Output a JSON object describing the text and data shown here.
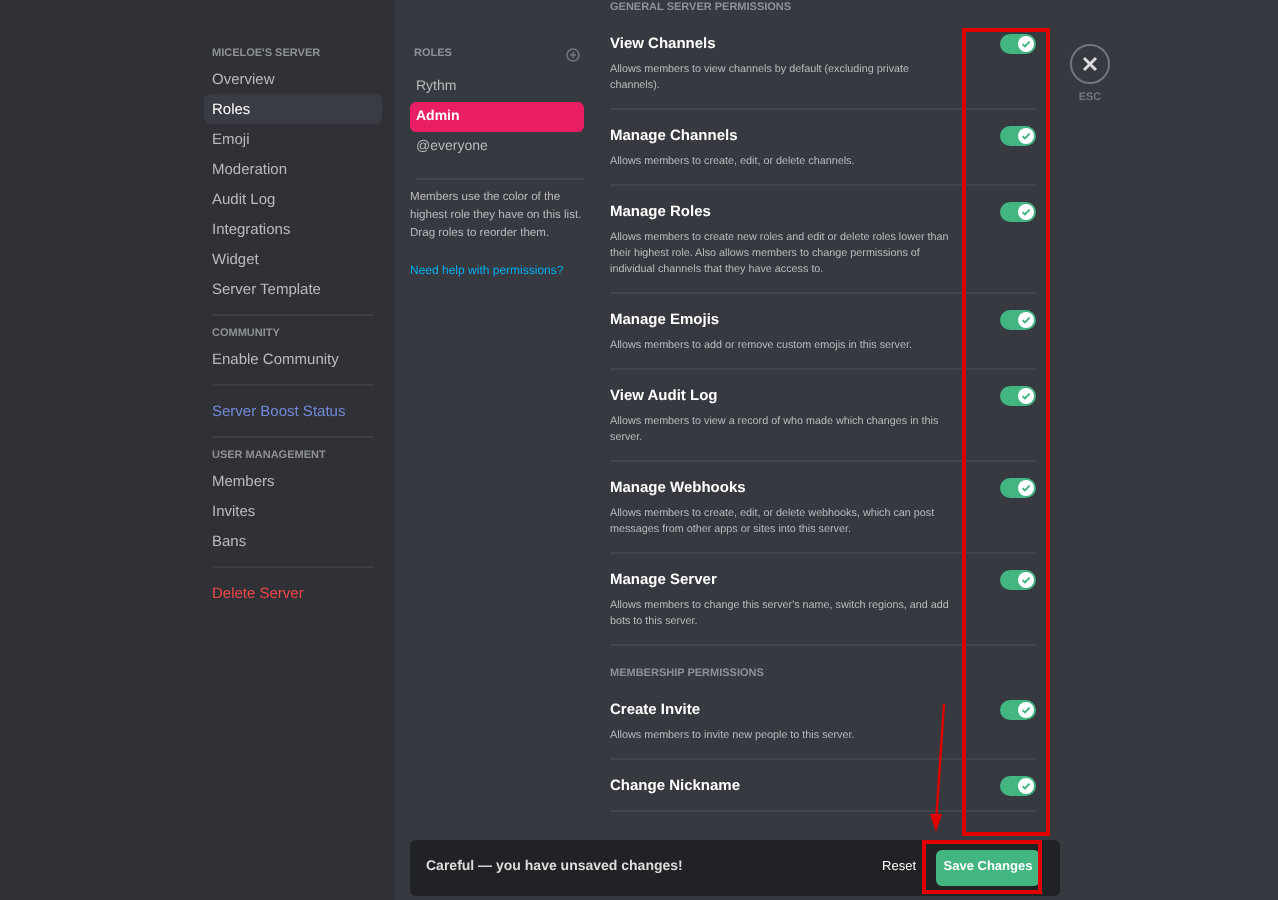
{
  "sidebar": {
    "server_heading": "MICELOE'S SERVER",
    "sections": [
      {
        "items": [
          {
            "label": "Overview",
            "selected": false,
            "kind": "normal"
          },
          {
            "label": "Roles",
            "selected": true,
            "kind": "normal"
          },
          {
            "label": "Emoji",
            "selected": false,
            "kind": "normal"
          },
          {
            "label": "Moderation",
            "selected": false,
            "kind": "normal"
          },
          {
            "label": "Audit Log",
            "selected": false,
            "kind": "normal"
          },
          {
            "label": "Integrations",
            "selected": false,
            "kind": "normal"
          },
          {
            "label": "Widget",
            "selected": false,
            "kind": "normal"
          },
          {
            "label": "Server Template",
            "selected": false,
            "kind": "normal"
          }
        ]
      },
      {
        "heading": "COMMUNITY",
        "items": [
          {
            "label": "Enable Community",
            "selected": false,
            "kind": "normal"
          }
        ]
      },
      {
        "items": [
          {
            "label": "Server Boost Status",
            "selected": false,
            "kind": "boost"
          }
        ]
      },
      {
        "heading": "USER MANAGEMENT",
        "items": [
          {
            "label": "Members",
            "selected": false,
            "kind": "normal"
          },
          {
            "label": "Invites",
            "selected": false,
            "kind": "normal"
          },
          {
            "label": "Bans",
            "selected": false,
            "kind": "normal"
          }
        ]
      },
      {
        "items": [
          {
            "label": "Delete Server",
            "selected": false,
            "kind": "danger"
          }
        ]
      }
    ]
  },
  "roles_panel": {
    "heading": "ROLES",
    "roles": [
      {
        "name": "Rythm",
        "selected": false
      },
      {
        "name": "Admin",
        "selected": true
      },
      {
        "name": "@everyone",
        "selected": false
      }
    ],
    "hint": "Members use the color of the highest role they have on this list. Drag roles to reorder them.",
    "help_link": "Need help with permissions?"
  },
  "permissions": {
    "sections": [
      {
        "heading": "GENERAL SERVER PERMISSIONS",
        "items": [
          {
            "title": "View Channels",
            "description": "Allows members to view channels by default (excluding private channels).",
            "enabled": true
          },
          {
            "title": "Manage Channels",
            "description": "Allows members to create, edit, or delete channels.",
            "enabled": true
          },
          {
            "title": "Manage Roles",
            "description": "Allows members to create new roles and edit or delete roles lower than their highest role. Also allows members to change permissions of individual channels that they have access to.",
            "enabled": true
          },
          {
            "title": "Manage Emojis",
            "description": "Allows members to add or remove custom emojis in this server.",
            "enabled": true
          },
          {
            "title": "View Audit Log",
            "description": "Allows members to view a record of who made which changes in this server.",
            "enabled": true
          },
          {
            "title": "Manage Webhooks",
            "description": "Allows members to create, edit, or delete webhooks, which can post messages from other apps or sites into this server.",
            "enabled": true
          },
          {
            "title": "Manage Server",
            "description": "Allows members to change this server's name, switch regions, and add bots to this server.",
            "enabled": true
          }
        ]
      },
      {
        "heading": "MEMBERSHIP PERMISSIONS",
        "items": [
          {
            "title": "Create Invite",
            "description": "Allows members to invite new people to this server.",
            "enabled": true
          },
          {
            "title": "Change Nickname",
            "enabled": true
          }
        ]
      }
    ]
  },
  "close": {
    "label": "ESC"
  },
  "unsaved_bar": {
    "message": "Careful — you have unsaved changes!",
    "reset": "Reset",
    "save": "Save Changes"
  }
}
